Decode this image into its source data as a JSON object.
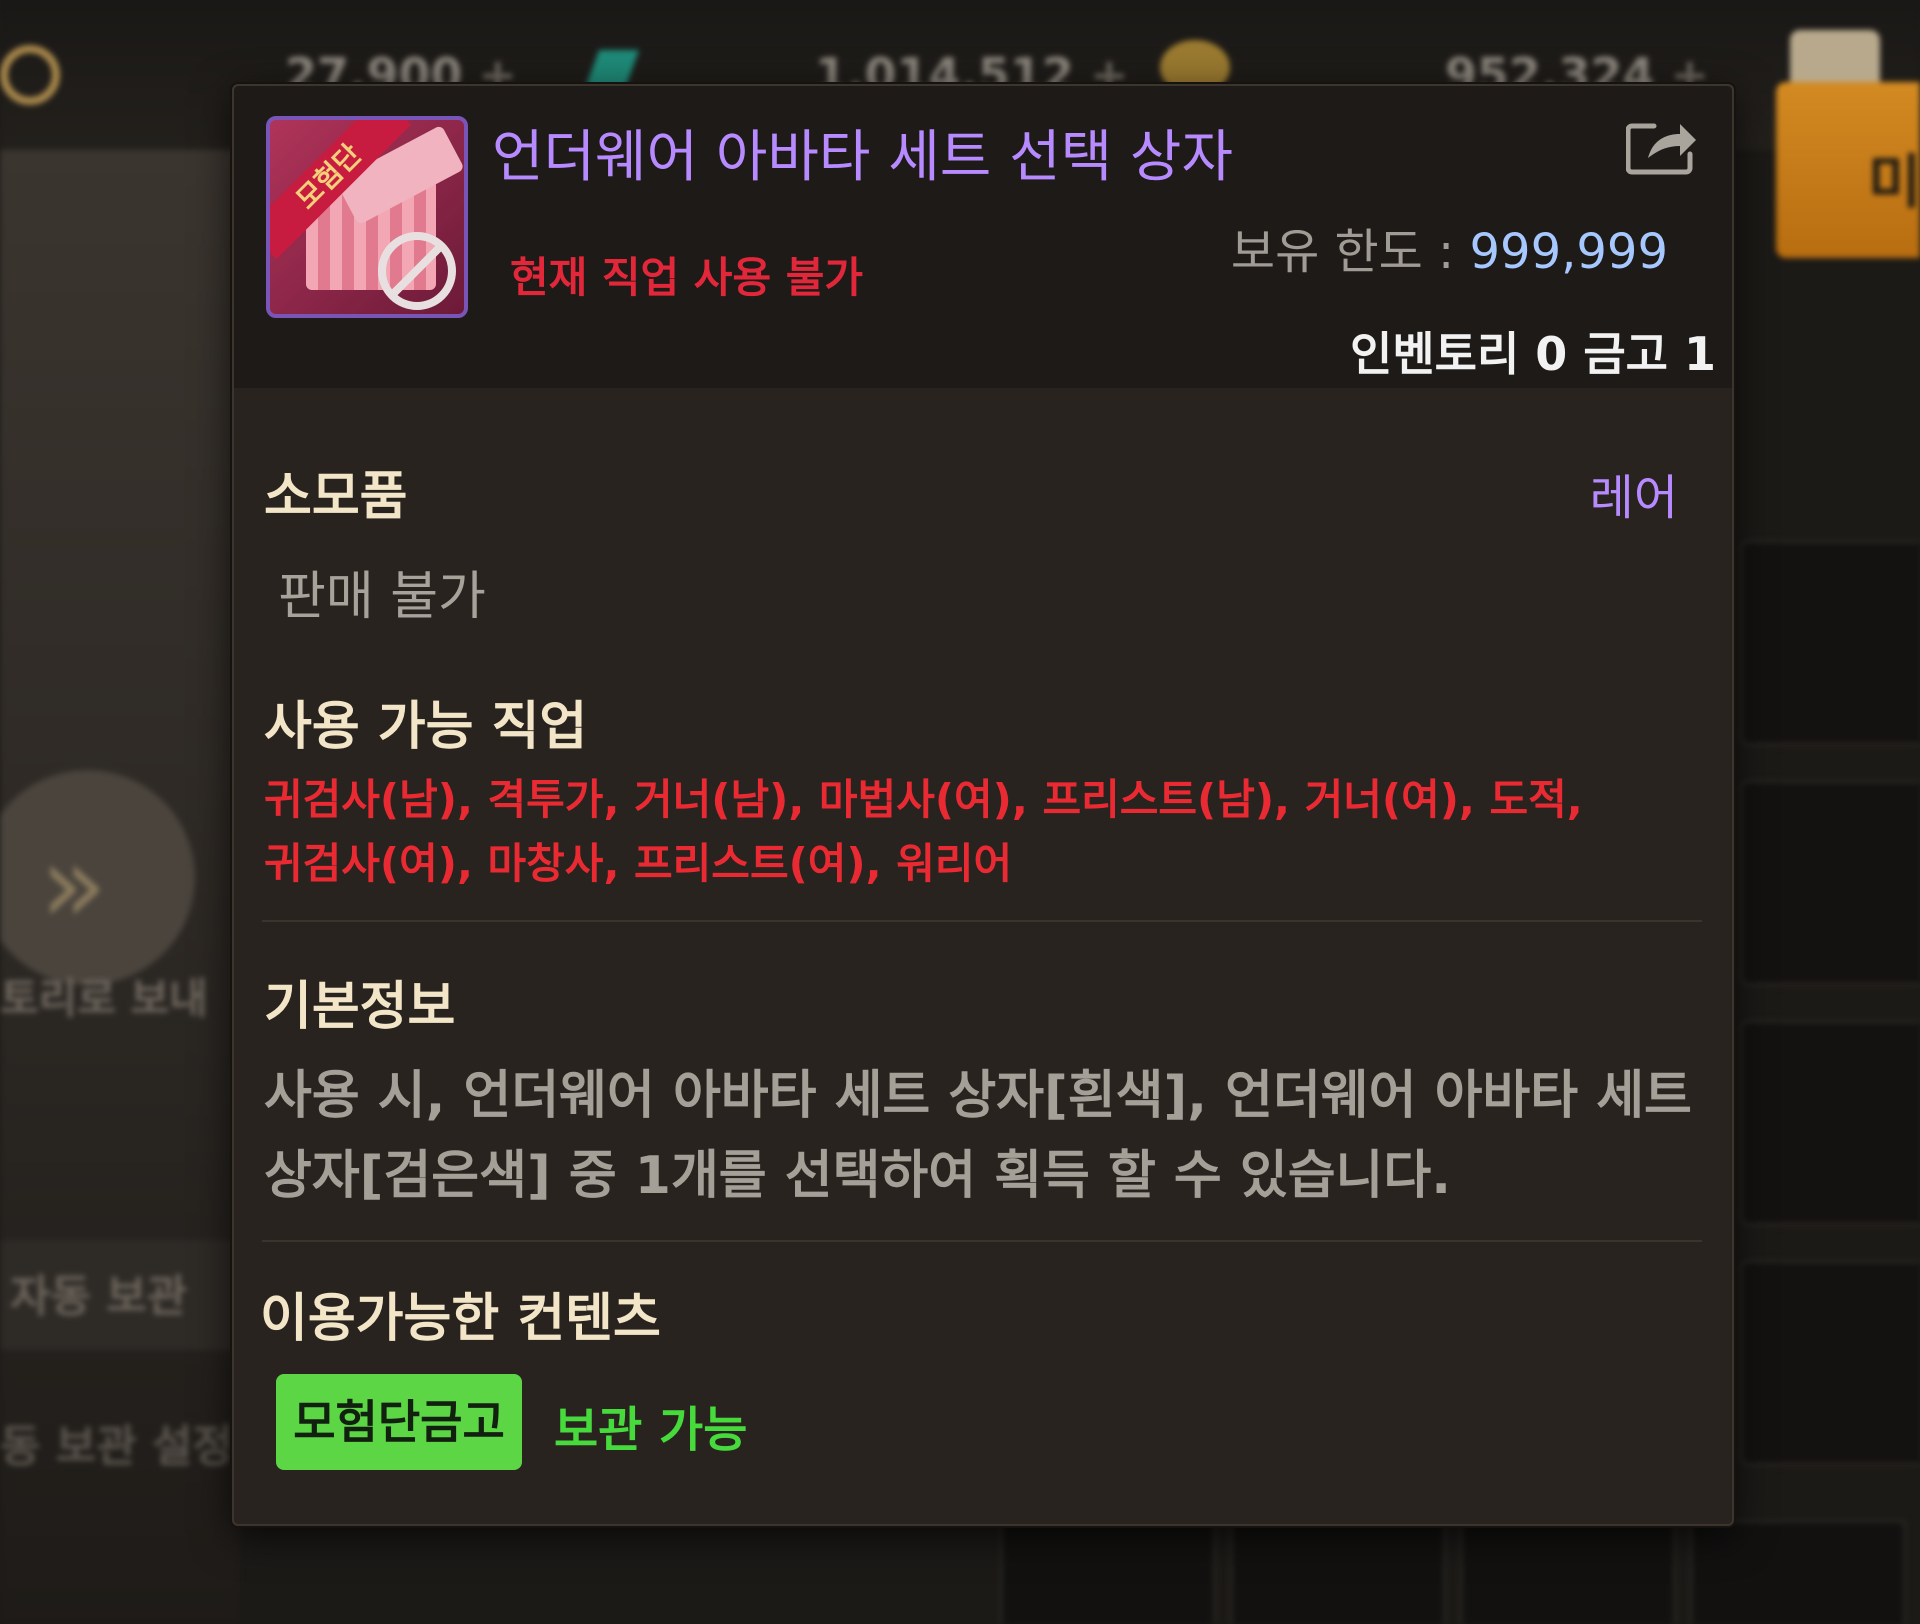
{
  "background": {
    "currency_1": "27,900",
    "currency_2": "1,014,512",
    "currency_3": "952,324",
    "plus_symbol": "+",
    "side_button_text": "미",
    "send_label": "토리로 보내",
    "auto_store_label": "자동 보관",
    "auto_store_settings_label": "동 보관 설정"
  },
  "item": {
    "name": "언더웨어 아바타 세트 선택 상자",
    "icon_name": "gift-box-icon",
    "icon_tag": "모험단",
    "usable_warning": "현재 직업 사용 불가",
    "hold_limit_label": "보유 한도 : ",
    "hold_limit_value": "999,999",
    "inventory_count": "인벤토리 0 금고 1",
    "type": "소모품",
    "grade": "레어",
    "sell_status": "판매 불가",
    "jobs_title": "사용 가능 직업",
    "jobs_line1": "귀검사(남), 격투가, 거너(남), 마법사(여), 프리스트(남), 거너(여), 도적,",
    "jobs_line2": "귀검사(여), 마창사, 프리스트(여), 워리어",
    "info_title": "기본정보",
    "description_line1": "사용 시, 언더웨어 아바타 세트 상자[흰색], 언더웨어 아바타 세트",
    "description_line2": "상자[검은색] 중 1개를 선택하여 획득 할 수 있습니다.",
    "contents_title": "이용가능한 컨텐츠",
    "badge_label": "모험단금고",
    "badge_status": "보관 가능"
  },
  "colors": {
    "title_purple": "#b78bff",
    "warning_red": "#e3273a",
    "badge_green": "#5cd645"
  }
}
